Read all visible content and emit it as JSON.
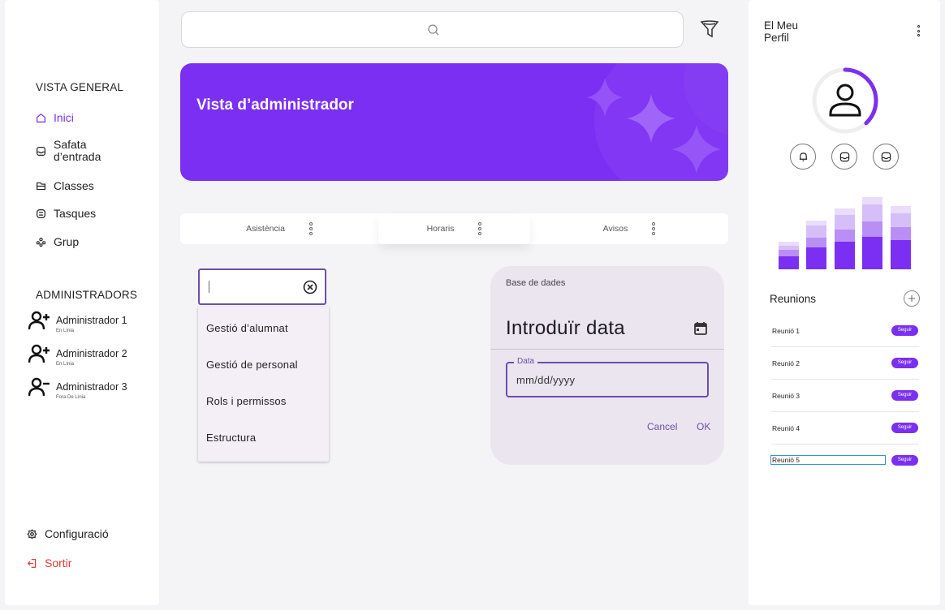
{
  "sidebar": {
    "overview_title": "VISTA GENERAL",
    "items": [
      {
        "label": "Inici",
        "icon": "home-icon"
      },
      {
        "label": "Safata d’entrada",
        "icon": "inbox-icon"
      },
      {
        "label": "Classes",
        "icon": "folder-icon"
      },
      {
        "label": "Tasques",
        "icon": "tasks-icon"
      },
      {
        "label": "Grup",
        "icon": "group-icon"
      }
    ],
    "admins_title": "ADMINISTRADORS",
    "admins": [
      {
        "name": "Administrador 1",
        "status": "En Línia",
        "icon": "user-plus-icon"
      },
      {
        "name": "Administrador 2",
        "status": "En Línia",
        "icon": "user-plus-icon"
      },
      {
        "name": "Administrador 3",
        "status": "Fora De Línia",
        "icon": "user-minus-icon"
      }
    ],
    "settings_label": "Configuració",
    "logout_label": "Sortir"
  },
  "search": {
    "placeholder": ""
  },
  "banner": {
    "title": "Vista d’administrador"
  },
  "tabs": [
    {
      "label": "Asistència"
    },
    {
      "label": "Horaris"
    },
    {
      "label": "Avisos"
    }
  ],
  "combobox": {
    "value": "",
    "options": [
      "Gestió d’alumnat",
      "Gestió de personal",
      "Rols i permissos",
      "Estructura"
    ]
  },
  "date_dialog": {
    "supporting_text": "Base de dades",
    "headline": "Introduïr data",
    "field_label": "Data",
    "field_value": "mm/dd/yyyy",
    "cancel_label": "Cancel",
    "ok_label": "OK"
  },
  "profile": {
    "title": "El Meu Perfil",
    "progress": 0.38,
    "buttons": [
      "bell-icon",
      "inbox-icon",
      "inbox-icon"
    ]
  },
  "activity_chart": {
    "colors": [
      "#7b2ff2",
      "#b98ef5",
      "#d6bff8",
      "#eadcfb"
    ]
  },
  "meetings": {
    "title": "Reunions",
    "follow_label": "Seguir",
    "items": [
      {
        "name": "Reunió 1"
      },
      {
        "name": "Reunió  2"
      },
      {
        "name": "Reunió 3"
      },
      {
        "name": "Reunió 4"
      },
      {
        "name": "Reunió 5"
      }
    ]
  },
  "colors": {
    "accent": "#7b2ff2",
    "outline": "#6d4ea8",
    "logout": "#e53935"
  }
}
